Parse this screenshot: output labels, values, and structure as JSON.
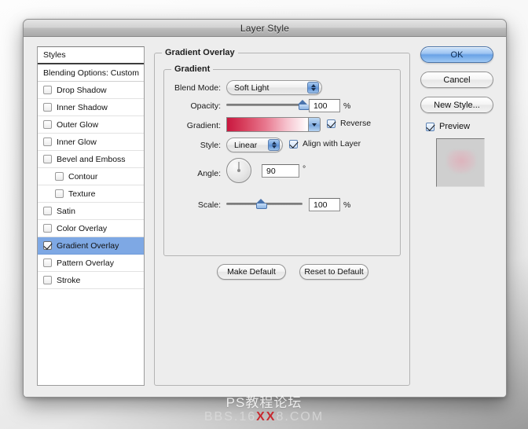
{
  "window": {
    "title": "Layer Style"
  },
  "styles_panel": {
    "header": "Styles",
    "blending_options": "Blending Options: Custom",
    "items": [
      {
        "label": "Drop Shadow",
        "checked": false,
        "indent": false,
        "selected": false
      },
      {
        "label": "Inner Shadow",
        "checked": false,
        "indent": false,
        "selected": false
      },
      {
        "label": "Outer Glow",
        "checked": false,
        "indent": false,
        "selected": false
      },
      {
        "label": "Inner Glow",
        "checked": false,
        "indent": false,
        "selected": false
      },
      {
        "label": "Bevel and Emboss",
        "checked": false,
        "indent": false,
        "selected": false
      },
      {
        "label": "Contour",
        "checked": false,
        "indent": true,
        "selected": false
      },
      {
        "label": "Texture",
        "checked": false,
        "indent": true,
        "selected": false
      },
      {
        "label": "Satin",
        "checked": false,
        "indent": false,
        "selected": false
      },
      {
        "label": "Color Overlay",
        "checked": false,
        "indent": false,
        "selected": false
      },
      {
        "label": "Gradient Overlay",
        "checked": true,
        "indent": false,
        "selected": true
      },
      {
        "label": "Pattern Overlay",
        "checked": false,
        "indent": false,
        "selected": false
      },
      {
        "label": "Stroke",
        "checked": false,
        "indent": false,
        "selected": false
      }
    ],
    "selection_color": "#7ea8e4"
  },
  "main": {
    "section_title": "Gradient Overlay",
    "group_title": "Gradient",
    "blend_mode": {
      "label": "Blend Mode:",
      "value": "Soft Light"
    },
    "opacity": {
      "label": "Opacity:",
      "value": "100",
      "unit": "%",
      "percent": 100
    },
    "gradient": {
      "label": "Gradient:",
      "start_color": "#c9173f",
      "end_color": "#ffffff",
      "reverse_label": "Reverse",
      "reverse_checked": true
    },
    "style": {
      "label": "Style:",
      "value": "Linear",
      "align_label": "Align with Layer",
      "align_checked": true
    },
    "angle": {
      "label": "Angle:",
      "value": "90",
      "unit": "°",
      "degrees": 90
    },
    "scale": {
      "label": "Scale:",
      "value": "100",
      "unit": "%",
      "percent": 45
    },
    "make_default": "Make Default",
    "reset_to_default": "Reset to Default"
  },
  "right_column": {
    "ok": "OK",
    "cancel": "Cancel",
    "new_style": "New Style...",
    "preview_label": "Preview",
    "preview_checked": true,
    "accent_color": "#69a2e6"
  },
  "watermark": {
    "line1": "PS教程论坛",
    "line2_a": "BBS.16",
    "line2_red": "XX",
    "line2_b": "8.COM"
  }
}
